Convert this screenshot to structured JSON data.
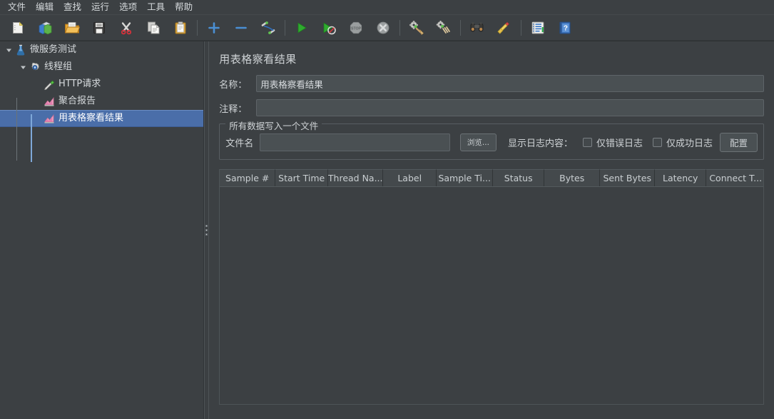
{
  "menubar": {
    "items": [
      {
        "label": "文件",
        "name": "menu-file"
      },
      {
        "label": "编辑",
        "name": "menu-edit"
      },
      {
        "label": "查找",
        "name": "menu-search"
      },
      {
        "label": "运行",
        "name": "menu-run"
      },
      {
        "label": "选项",
        "name": "menu-options"
      },
      {
        "label": "工具",
        "name": "menu-tools"
      },
      {
        "label": "帮助",
        "name": "menu-help"
      }
    ]
  },
  "toolbar": {
    "buttons": [
      {
        "icon": "new-document-icon",
        "name": "toolbar-new"
      },
      {
        "icon": "templates-icon",
        "name": "toolbar-templates"
      },
      {
        "icon": "open-folder-icon",
        "name": "toolbar-open"
      },
      {
        "icon": "save-floppy-icon",
        "name": "toolbar-save"
      },
      {
        "icon": "cut-scissors-icon",
        "name": "toolbar-cut"
      },
      {
        "icon": "copy-icon",
        "name": "toolbar-copy"
      },
      {
        "icon": "paste-clipboard-icon",
        "name": "toolbar-paste"
      },
      {
        "icon": "plus-icon",
        "name": "toolbar-expand-all"
      },
      {
        "icon": "minus-icon",
        "name": "toolbar-collapse-all"
      },
      {
        "icon": "toggle-icon",
        "name": "toolbar-toggle"
      },
      {
        "icon": "play-start-icon",
        "name": "toolbar-start"
      },
      {
        "icon": "play-no-timers-icon",
        "name": "toolbar-start-no-pauses"
      },
      {
        "icon": "stop-icon",
        "name": "toolbar-stop"
      },
      {
        "icon": "shutdown-icon",
        "name": "toolbar-shutdown"
      },
      {
        "icon": "clear-icon",
        "name": "toolbar-clear"
      },
      {
        "icon": "clear-all-icon",
        "name": "toolbar-clear-all"
      },
      {
        "icon": "search-binoculars-icon",
        "name": "toolbar-search"
      },
      {
        "icon": "reset-search-broom-icon",
        "name": "toolbar-reset-search"
      },
      {
        "icon": "function-helper-icon",
        "name": "toolbar-function-helper"
      },
      {
        "icon": "help-book-icon",
        "name": "toolbar-help"
      }
    ]
  },
  "tree": {
    "nodes": [
      {
        "label": "微服务测试",
        "icon": "test-plan-icon",
        "depth": 0,
        "expanded": true,
        "selected": false,
        "name": "tree-node-test-plan"
      },
      {
        "label": "线程组",
        "icon": "thread-group-gear-icon",
        "depth": 1,
        "expanded": true,
        "selected": false,
        "name": "tree-node-thread-group"
      },
      {
        "label": "HTTP请求",
        "icon": "http-request-icon",
        "depth": 2,
        "expanded": null,
        "selected": false,
        "name": "tree-node-http-request"
      },
      {
        "label": "聚合报告",
        "icon": "report-chart-icon",
        "depth": 2,
        "expanded": null,
        "selected": false,
        "name": "tree-node-aggregate-report"
      },
      {
        "label": "用表格察看结果",
        "icon": "report-chart-icon",
        "depth": 2,
        "expanded": null,
        "selected": true,
        "name": "tree-node-view-results-in-table"
      }
    ]
  },
  "panel": {
    "title": "用表格察看结果",
    "name_label": "名称：",
    "name_value": "用表格察看结果",
    "comment_label": "注释：",
    "comment_value": "",
    "comment_placeholder": "",
    "group": {
      "title": "所有数据写入一个文件",
      "filename_label": "文件名",
      "filename_value": "",
      "browse_button": "浏览...",
      "log_display_label": "显示日志内容：",
      "checkbox_errors": "仅错误日志",
      "checkbox_success": "仅成功日志",
      "config_button": "配置"
    }
  },
  "table": {
    "columns": [
      {
        "label": "Sample #",
        "width": 78
      },
      {
        "label": "Start Time",
        "width": 74
      },
      {
        "label": "Thread Na...",
        "width": 77
      },
      {
        "label": "Label",
        "width": 75
      },
      {
        "label": "Sample Ti...",
        "width": 79
      },
      {
        "label": "Status",
        "width": 72
      },
      {
        "label": "Bytes",
        "width": 78
      },
      {
        "label": "Sent Bytes",
        "width": 77
      },
      {
        "label": "Latency",
        "width": 72
      },
      {
        "label": "Connect T...",
        "width": 83
      }
    ],
    "rows": []
  },
  "colors": {
    "background": "#3c4043",
    "selection": "#4a6ea9",
    "field_background": "#4a5053",
    "text": "#cfd3d6",
    "accent_blue": "#4a8fd4"
  }
}
